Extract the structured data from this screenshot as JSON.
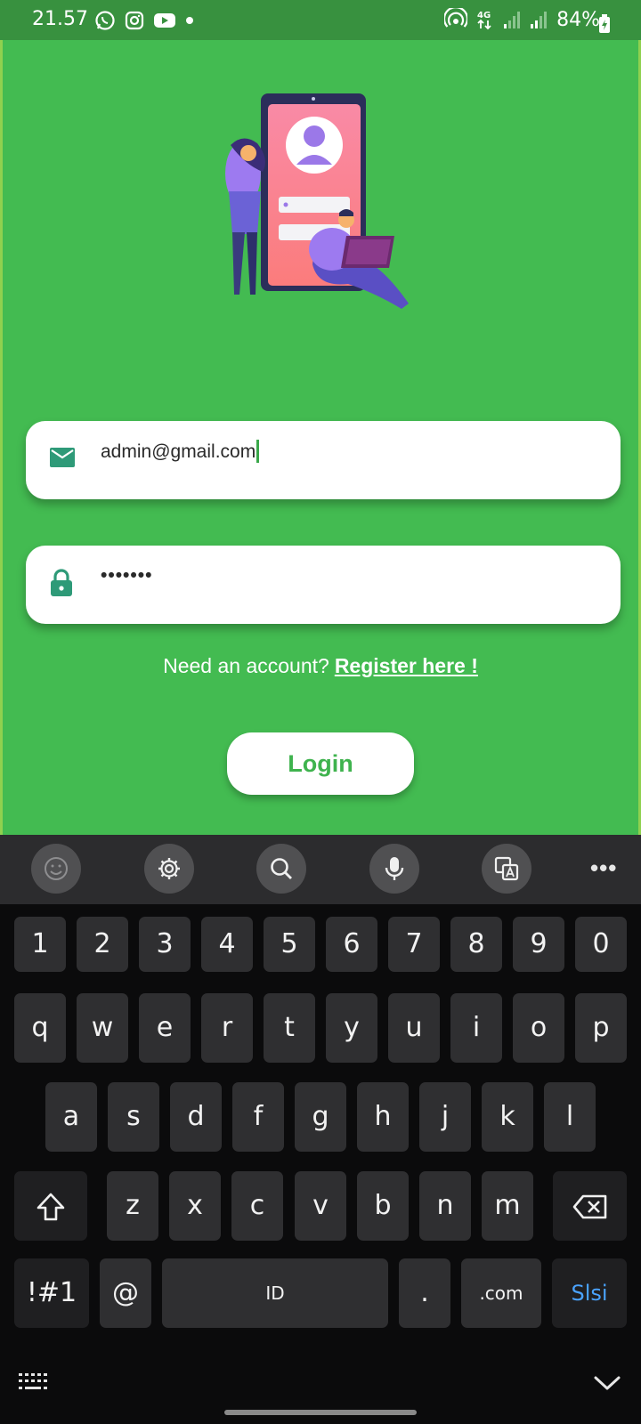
{
  "status_bar": {
    "time": "21.57",
    "battery": "84%",
    "network": "4G"
  },
  "login": {
    "email_value": "admin@gmail.com",
    "password_value": "•••••••",
    "register_prompt": "Need an account?",
    "register_link": "Register here !",
    "login_button": "Login"
  },
  "keyboard": {
    "toolbar": [
      "emoji-icon",
      "settings-icon",
      "search-icon",
      "microphone-icon",
      "translate-icon",
      "more-icon"
    ],
    "row_numbers": [
      "1",
      "2",
      "3",
      "4",
      "5",
      "6",
      "7",
      "8",
      "9",
      "0"
    ],
    "row1": [
      "q",
      "w",
      "e",
      "r",
      "t",
      "y",
      "u",
      "i",
      "o",
      "p"
    ],
    "row2": [
      "a",
      "s",
      "d",
      "f",
      "g",
      "h",
      "j",
      "k",
      "l"
    ],
    "row3": [
      "z",
      "x",
      "c",
      "v",
      "b",
      "n",
      "m"
    ],
    "symbols_key": "!#1",
    "at_key": "@",
    "space_label": "ID",
    "period_key": ".",
    "dotcom_key": ".com",
    "action_key": "Slsi"
  },
  "colors": {
    "app_bg": "#43bb51",
    "status_bg": "#38913f",
    "icon_teal": "#2e9a78",
    "keyboard_bg": "#0b0b0c"
  }
}
